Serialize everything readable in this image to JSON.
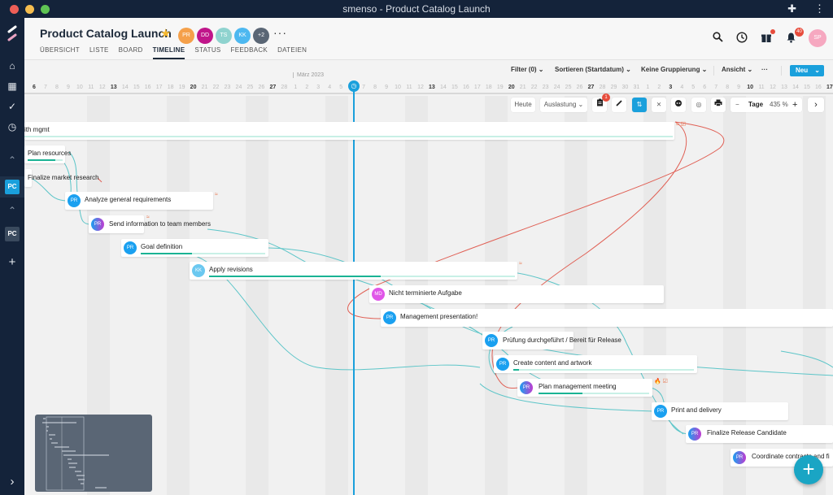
{
  "window": {
    "title": "smenso - Product Catalog Launch"
  },
  "sidebar": {
    "items": [
      {
        "name": "home",
        "icon": "⌂"
      },
      {
        "name": "dashboard",
        "icon": "▦"
      },
      {
        "name": "tasks",
        "icon": "✓"
      },
      {
        "name": "history",
        "icon": "◷"
      },
      {
        "name": "collapse-1",
        "icon": "⌃"
      },
      {
        "name": "project-pc-active",
        "label": "PC"
      },
      {
        "name": "collapse-2",
        "icon": "⌃"
      },
      {
        "name": "project-pc",
        "label": "PC"
      },
      {
        "name": "add",
        "icon": "+"
      },
      {
        "name": "expand",
        "icon": "›"
      }
    ]
  },
  "header": {
    "project_title": "Product Catalog Launch",
    "star_icon": "★",
    "members": [
      {
        "initials": "PR",
        "color": "#f5a04a"
      },
      {
        "initials": "DD",
        "color": "#c0168a"
      },
      {
        "initials": "TS",
        "color": "#8fd3cf"
      },
      {
        "initials": "KK",
        "color": "#4db8f0"
      },
      {
        "initials": "+2",
        "color": "#5a6675"
      }
    ],
    "more": "···",
    "tabs": [
      "ÜBERSICHT",
      "LISTE",
      "BOARD",
      "TIMELINE",
      "STATUS",
      "FEEDBACK",
      "DATEIEN"
    ],
    "active_tab": "TIMELINE",
    "notification_count": "40",
    "user_initials": "SP"
  },
  "toolbar": {
    "filter": "Filter (0) ⌄",
    "sort": "Sortieren (Startdatum) ⌄",
    "grouping": "Keine Gruppierung ⌄",
    "view": "Ansicht ⌄",
    "more": "···",
    "new_button": "Neu",
    "new_chevron": "⌄"
  },
  "timeline": {
    "month_label": "März 2023",
    "days": [
      "6",
      "7",
      "8",
      "9",
      "10",
      "11",
      "12",
      "13",
      "14",
      "15",
      "16",
      "17",
      "18",
      "19",
      "20",
      "21",
      "22",
      "23",
      "24",
      "25",
      "26",
      "27",
      "28",
      "1",
      "2",
      "3",
      "4",
      "5",
      "6",
      "7",
      "8",
      "9",
      "10",
      "11",
      "12",
      "13",
      "14",
      "15",
      "16",
      "17",
      "18",
      "19",
      "20",
      "21",
      "22",
      "23",
      "24",
      "25",
      "26",
      "27",
      "28",
      "29",
      "30",
      "31",
      "1",
      "2",
      "3",
      "4",
      "5",
      "6",
      "7",
      "8",
      "9",
      "10",
      "11",
      "12",
      "13",
      "14",
      "15",
      "16",
      "17"
    ],
    "bold_days_idx": [
      0,
      7,
      14,
      21,
      35,
      42,
      49,
      56,
      63,
      70
    ],
    "controls": {
      "today": "Heute",
      "utilization": "Auslastung ⌄",
      "clipboard_badge": "1",
      "zoom_unit": "Tage",
      "zoom_level": "435 %",
      "minus": "−",
      "plus": "+",
      "next": "›"
    }
  },
  "tasks": [
    {
      "label": "ith mgmt",
      "avatar": null,
      "progress": 0,
      "flags": "≈ ☑"
    },
    {
      "label": "Plan resources",
      "avatar": null,
      "progress": 0.8
    },
    {
      "label": "Finalize market research",
      "avatar": null,
      "progress": null
    },
    {
      "label": "Analyze general requirements",
      "avatar": "PR",
      "progress": null,
      "flags": "≈"
    },
    {
      "label": "Send information to team members",
      "avatar": "PR",
      "progress": null,
      "flags": "≈"
    },
    {
      "label": "Goal definition",
      "avatar": "PR",
      "progress": 0.41
    },
    {
      "label": "Apply revisions",
      "avatar": "KK",
      "progress": 0.56,
      "flags": "≈"
    },
    {
      "label": "Nicht terminierte Aufgabe",
      "avatar": "MD",
      "progress": null
    },
    {
      "label": "Management presentation!",
      "avatar": "PR",
      "progress": null
    },
    {
      "label": "Prüfung durchgeführt / Bereit für Release",
      "avatar": "PR",
      "progress": null
    },
    {
      "label": "Create content and artwork",
      "avatar": "PR",
      "progress": 0.03
    },
    {
      "label": "Plan management meeting",
      "avatar": "PR",
      "progress": 0.4,
      "flags": "🔥 ☑"
    },
    {
      "label": "Print and delivery",
      "avatar": "PR",
      "progress": null
    },
    {
      "label": "Finalize Release Candidate",
      "avatar": "PR",
      "progress": null
    },
    {
      "label": "Coordinate contracts and fi",
      "avatar": "PR",
      "progress": null
    }
  ],
  "fab": "+"
}
